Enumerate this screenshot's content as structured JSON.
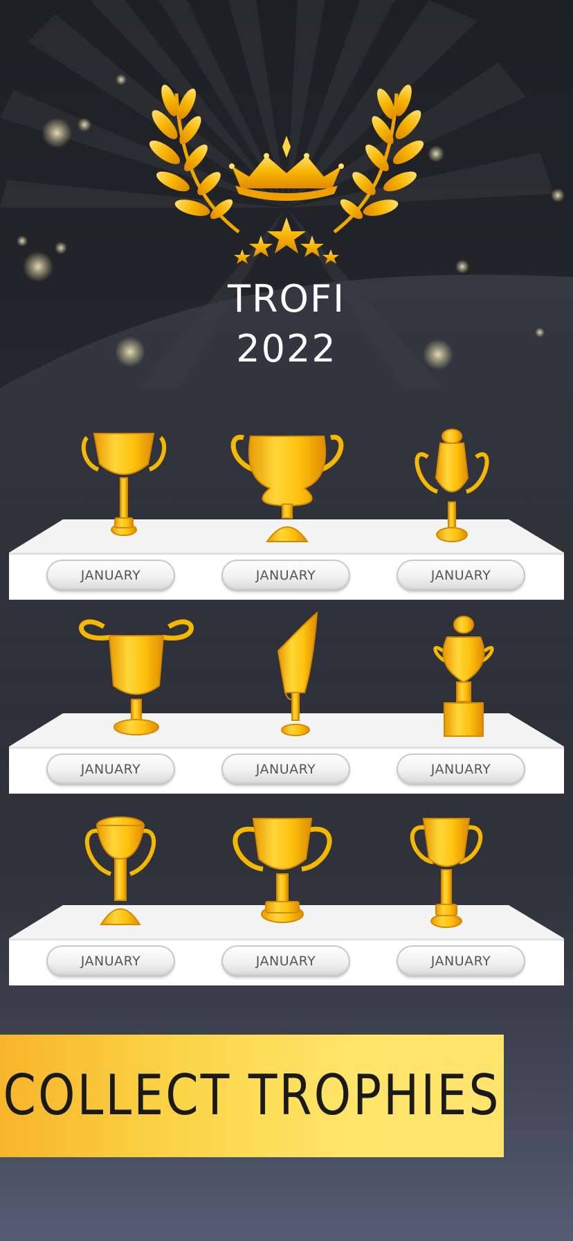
{
  "hero": {
    "title_line1": "TROFI",
    "title_line2": "2022"
  },
  "shelves": [
    {
      "plaques": [
        "JANUARY",
        "JANUARY",
        "JANUARY"
      ]
    },
    {
      "plaques": [
        "JANUARY",
        "JANUARY",
        "JANUARY"
      ]
    },
    {
      "plaques": [
        "JANUARY",
        "JANUARY",
        "JANUARY"
      ]
    }
  ],
  "banner": {
    "text": "COLLECT TROPHIES"
  },
  "colors": {
    "gold": "#f5b800",
    "gold_light": "#ffd84a",
    "banner_yellow": "#ffe46e",
    "background_dark": "#1e1f23"
  },
  "icons": [
    "laurel-wreath-icon",
    "crown-icon",
    "star-icon",
    "trophy-icon"
  ]
}
